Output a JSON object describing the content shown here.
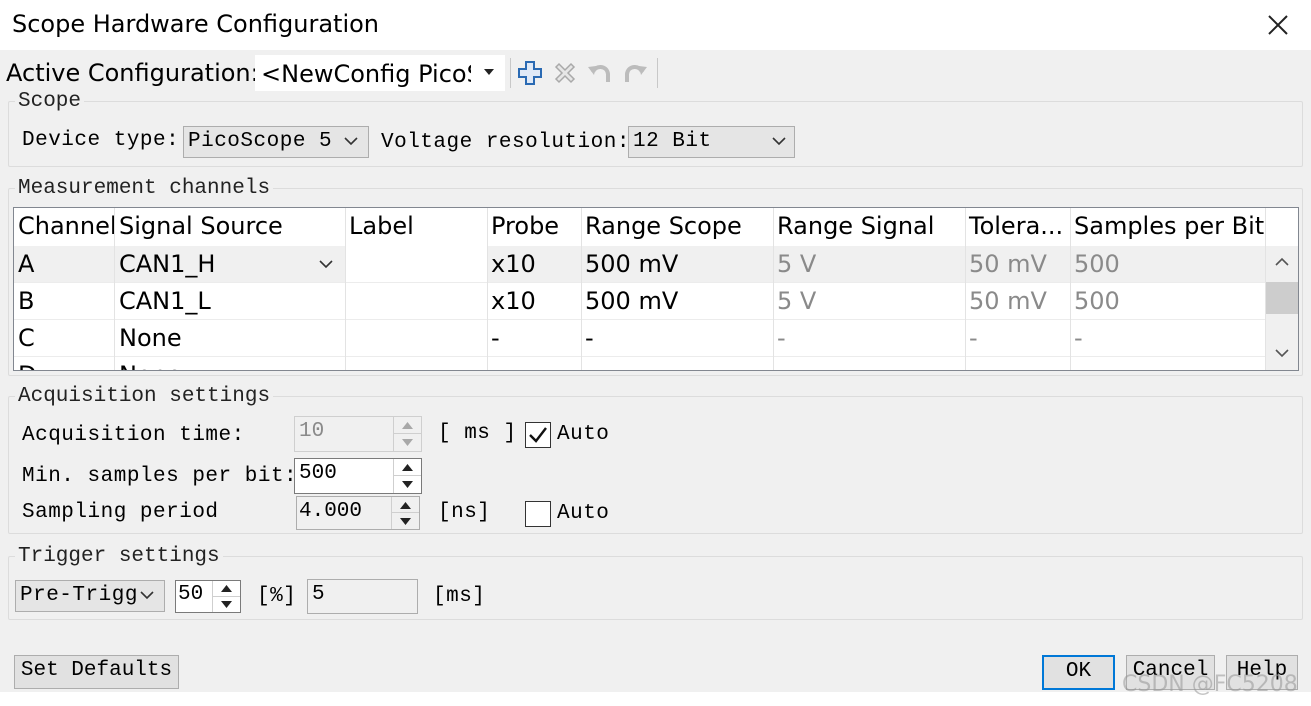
{
  "window": {
    "title": "Scope Hardware Configuration"
  },
  "toolbar": {
    "active_label": "Active Configuration:",
    "config_value": "<NewConfig PicoS",
    "icons": [
      "add-icon",
      "delete-icon",
      "undo-icon",
      "redo-icon"
    ]
  },
  "scope": {
    "title": "Scope",
    "device_type_label": "Device type:",
    "device_type_value": "PicoScope 5",
    "voltage_label": "Voltage resolution:",
    "voltage_value": "12 Bit"
  },
  "channels": {
    "title": "Measurement channels",
    "columns": [
      "Channel",
      "Signal Source",
      "Label",
      "Probe",
      "Range Scope",
      "Range Signal",
      "Tolera...",
      "Samples per Bit"
    ],
    "rows": [
      {
        "channel": "A",
        "source": "CAN1_H",
        "label": "",
        "probe": "x10",
        "range_scope": "500 mV",
        "range_signal": "5 V",
        "tolerance": "50 mV",
        "samples": "500"
      },
      {
        "channel": "B",
        "source": "CAN1_L",
        "label": "",
        "probe": "x10",
        "range_scope": "500 mV",
        "range_signal": "5 V",
        "tolerance": "50 mV",
        "samples": "500"
      },
      {
        "channel": "C",
        "source": "None",
        "label": "",
        "probe": "-",
        "range_scope": "-",
        "range_signal": "-",
        "tolerance": "-",
        "samples": "-"
      },
      {
        "channel": "D",
        "source": "None",
        "label": "",
        "probe": "",
        "range_scope": "",
        "range_signal": "",
        "tolerance": "",
        "samples": ""
      }
    ]
  },
  "acquisition": {
    "title": "Acquisition settings",
    "time_label": "Acquisition time:",
    "time_value": "10",
    "time_unit": "[ ms ]",
    "time_auto_label": "Auto",
    "time_auto_checked": true,
    "min_samples_label": "Min. samples per bit:",
    "min_samples_value": "500",
    "sampling_label": "Sampling period",
    "sampling_value": "4.000",
    "sampling_unit": "[ns]",
    "sampling_auto_label": "Auto",
    "sampling_auto_checked": false
  },
  "trigger": {
    "title": "Trigger settings",
    "mode_value": "Pre-Trigg",
    "percent_value": "50",
    "percent_unit": "[%]",
    "ms_value": "5",
    "ms_unit": "[ms]"
  },
  "buttons": {
    "set_defaults": "Set Defaults",
    "ok": "OK",
    "cancel": "Cancel",
    "help": "Help"
  },
  "watermark": "CSDN @FC5208"
}
